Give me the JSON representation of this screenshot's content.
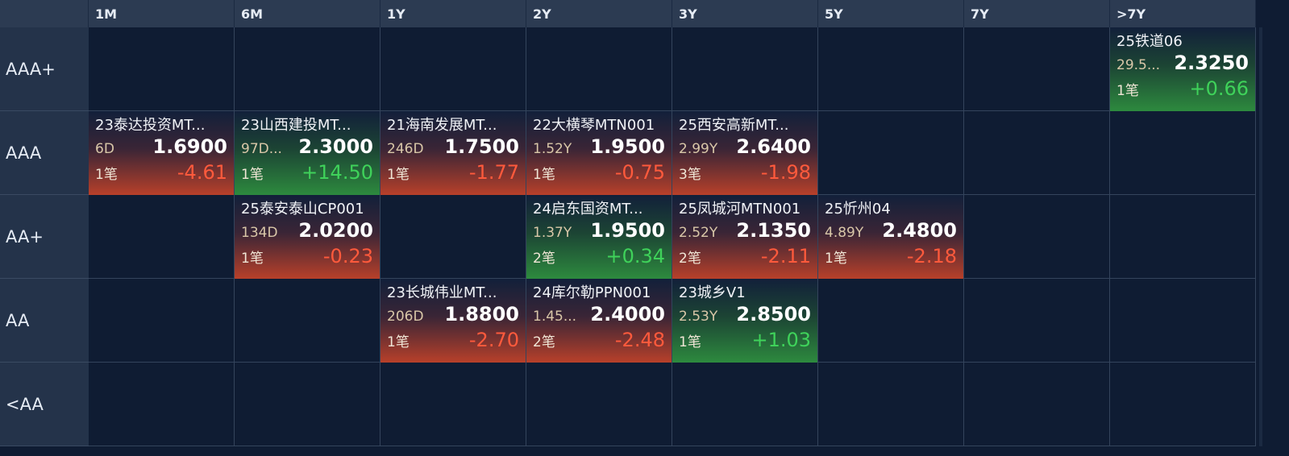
{
  "columns": [
    "1M",
    "6M",
    "1Y",
    "2Y",
    "3Y",
    "5Y",
    "7Y",
    ">7Y"
  ],
  "rows": [
    "AAA+",
    "AAA",
    "AA+",
    "AA",
    "<AA"
  ],
  "colors": {
    "up": "#3fd25a",
    "down": "#ff5a3c",
    "bg": "#0f1c33"
  },
  "cells": [
    {
      "row": 0,
      "col": 7,
      "name": "25铁道06",
      "term": "29.5...",
      "yield": "2.3250",
      "count": "1笔",
      "change": "+0.66",
      "dir": "up"
    },
    {
      "row": 1,
      "col": 0,
      "name": "23泰达投资MT...",
      "term": "6D",
      "yield": "1.6900",
      "count": "1笔",
      "change": "-4.61",
      "dir": "down"
    },
    {
      "row": 1,
      "col": 1,
      "name": "23山西建投MT...",
      "term": "97D...",
      "yield": "2.3000",
      "count": "1笔",
      "change": "+14.50",
      "dir": "up"
    },
    {
      "row": 1,
      "col": 2,
      "name": "21海南发展MT...",
      "term": "246D",
      "yield": "1.7500",
      "count": "1笔",
      "change": "-1.77",
      "dir": "down"
    },
    {
      "row": 1,
      "col": 3,
      "name": "22大横琴MTN001",
      "term": "1.52Y",
      "yield": "1.9500",
      "count": "1笔",
      "change": "-0.75",
      "dir": "down"
    },
    {
      "row": 1,
      "col": 4,
      "name": "25西安高新MT...",
      "term": "2.99Y",
      "yield": "2.6400",
      "count": "3笔",
      "change": "-1.98",
      "dir": "down"
    },
    {
      "row": 2,
      "col": 1,
      "name": "25泰安泰山CP001",
      "term": "134D",
      "yield": "2.0200",
      "count": "1笔",
      "change": "-0.23",
      "dir": "down"
    },
    {
      "row": 2,
      "col": 3,
      "name": "24启东国资MT...",
      "term": "1.37Y",
      "yield": "1.9500",
      "count": "2笔",
      "change": "+0.34",
      "dir": "up"
    },
    {
      "row": 2,
      "col": 4,
      "name": "25凤城河MTN001",
      "term": "2.52Y",
      "yield": "2.1350",
      "count": "2笔",
      "change": "-2.11",
      "dir": "down"
    },
    {
      "row": 2,
      "col": 5,
      "name": "25忻州04",
      "term": "4.89Y",
      "yield": "2.4800",
      "count": "1笔",
      "change": "-2.18",
      "dir": "down"
    },
    {
      "row": 3,
      "col": 2,
      "name": "23长城伟业MT...",
      "term": "206D",
      "yield": "1.8800",
      "count": "1笔",
      "change": "-2.70",
      "dir": "down"
    },
    {
      "row": 3,
      "col": 3,
      "name": "24库尔勒PPN001",
      "term": "1.45...",
      "yield": "2.4000",
      "count": "2笔",
      "change": "-2.48",
      "dir": "down"
    },
    {
      "row": 3,
      "col": 4,
      "name": "23城乡V1",
      "term": "2.53Y",
      "yield": "2.8500",
      "count": "1笔",
      "change": "+1.03",
      "dir": "up"
    }
  ]
}
